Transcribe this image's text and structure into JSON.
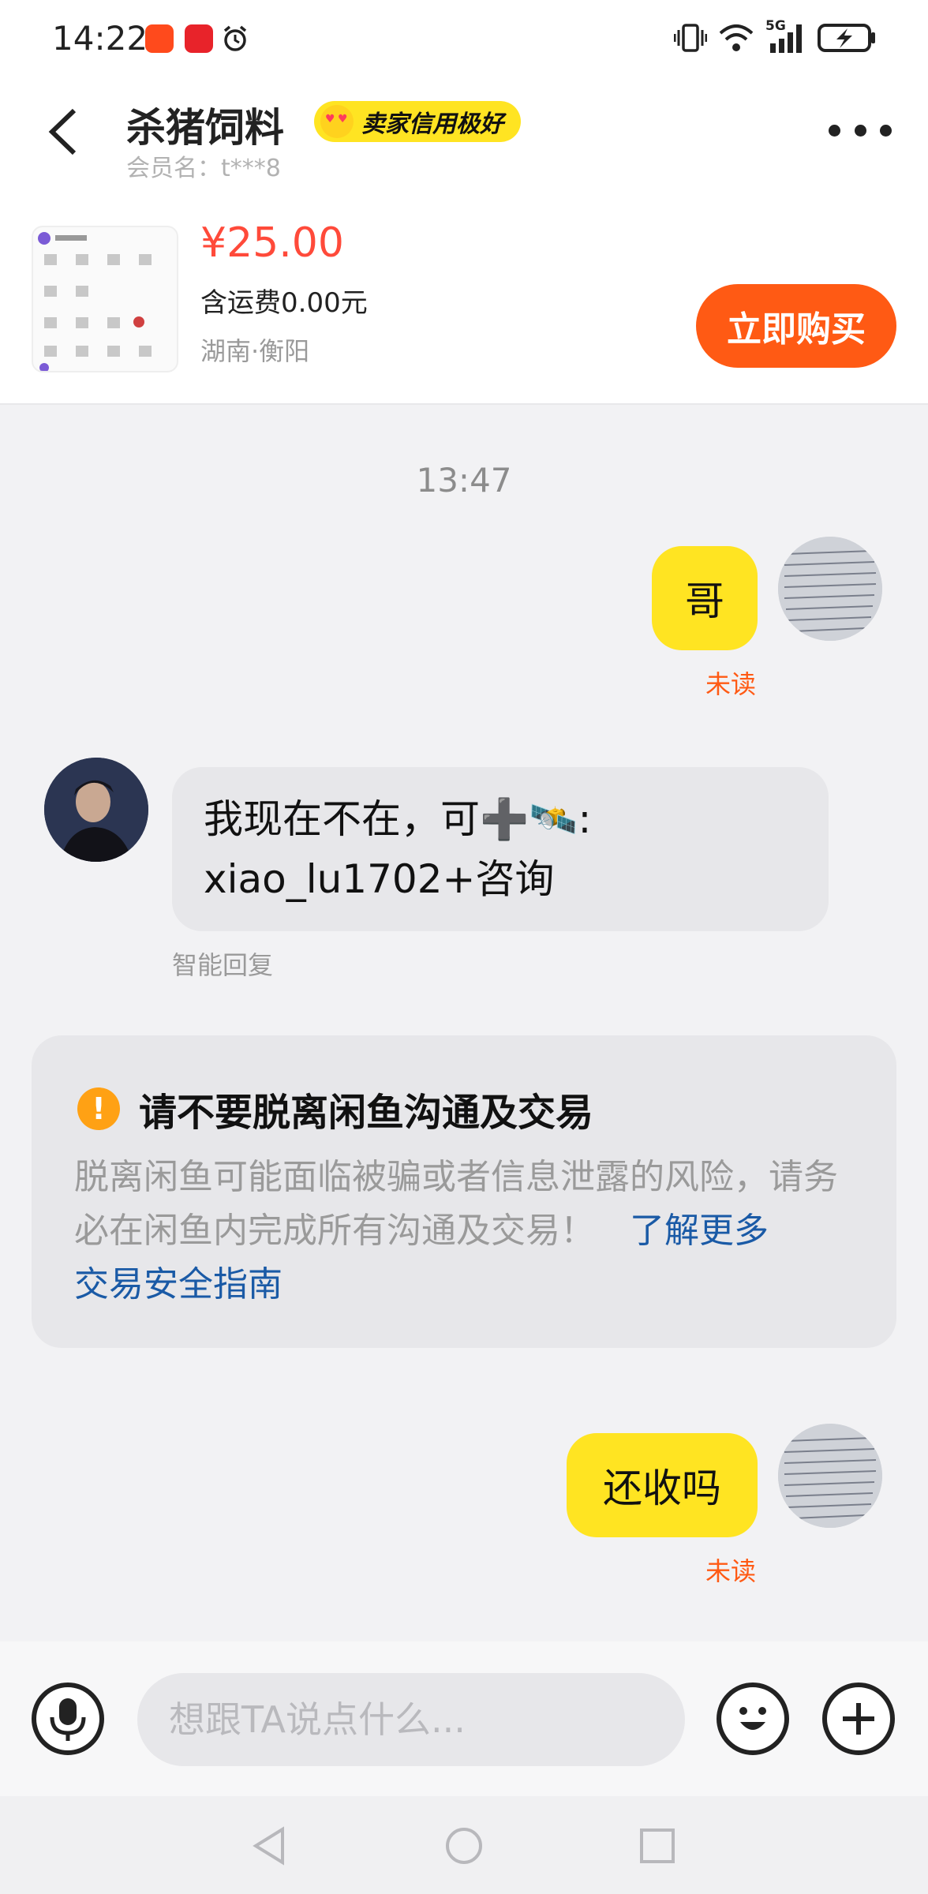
{
  "status_bar": {
    "time": "14:22",
    "network": "5G"
  },
  "header": {
    "title": "杀猪饲料",
    "credit_badge": "卖家信用极好",
    "member_name": "会员名：t***8"
  },
  "product": {
    "price": "¥25.00",
    "shipping": "含运费0.00元",
    "location": "湖南·衡阳",
    "buy_label": "立即购买"
  },
  "chat": {
    "timestamp": "13:47",
    "messages": [
      {
        "from": "me",
        "text": "哥",
        "status": "未读"
      },
      {
        "from": "other",
        "line1": "我现在不在，可➕🛰️:",
        "line2": "xiao_lu1702+咨询",
        "tag": "智能回复"
      },
      {
        "from": "me",
        "text": "还收吗",
        "status": "未读"
      }
    ],
    "warning": {
      "title": "请不要脱离闲鱼沟通及交易",
      "body": "脱离闲鱼可能面临被骗或者信息泄露的风险，请务必在闲鱼内完成所有沟通及交易！",
      "link1": "了解更多",
      "link2": "交易安全指南"
    }
  },
  "input": {
    "placeholder": "想跟TA说点什么..."
  },
  "colors": {
    "accent_yellow": "#ffe422",
    "price_red": "#ff4a3a",
    "buy_orange": "#ff5a14",
    "link_blue": "#1a5aa6"
  },
  "icons": [
    "back-icon",
    "more-icon",
    "voice-icon",
    "emoji-icon",
    "plus-icon",
    "warning-icon",
    "nav-back-icon",
    "nav-home-icon",
    "nav-recent-icon"
  ]
}
